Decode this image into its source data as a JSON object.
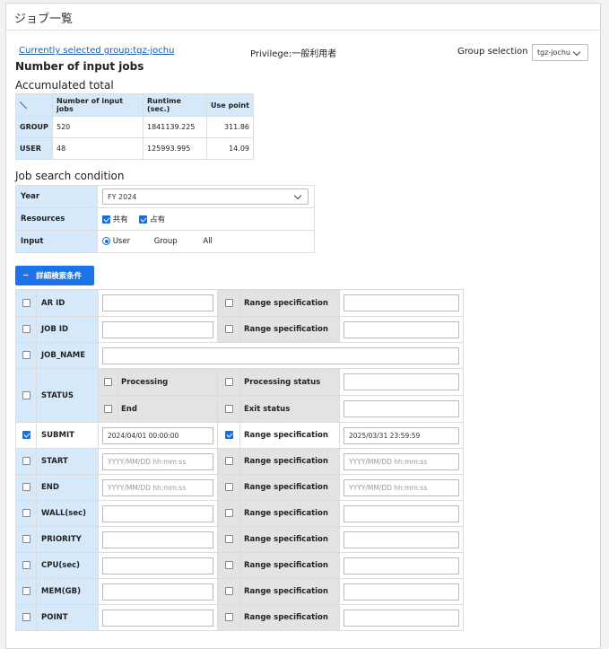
{
  "header": {
    "title": "ジョブ一覧"
  },
  "top": {
    "current_group_link": "Currently selected group:tgz-jochu",
    "privilege": "Privilege:一般利用者",
    "group_selection_label": "Group selection",
    "group_selection_value": "tgz-jochu"
  },
  "sections": {
    "input_jobs_title": "Number of input jobs",
    "accumulated_title": "Accumulated total",
    "search_title": "Job search condition"
  },
  "accumulated": {
    "corner": "＼",
    "columns": [
      "Number of input jobs",
      "Runtime (sec.)",
      "Use point"
    ],
    "rows": [
      {
        "label": "GROUP",
        "jobs": "520",
        "runtime": "1841139.225",
        "point": "311.86"
      },
      {
        "label": "USER",
        "jobs": "48",
        "runtime": "125993.995",
        "point": "14.09"
      }
    ]
  },
  "search": {
    "year_label": "Year",
    "year_value": "FY 2024",
    "resources_label": "Resources",
    "resources": [
      {
        "label": "共有",
        "checked": true
      },
      {
        "label": "占有",
        "checked": true
      }
    ],
    "input_label": "Input",
    "input_options": [
      {
        "label": "User",
        "selected": true
      },
      {
        "label": "Group",
        "selected": false
      },
      {
        "label": "All",
        "selected": false
      }
    ]
  },
  "detail_button": {
    "icon": "minus-icon",
    "symbol": "−",
    "label": "詳細検索条件"
  },
  "fields": {
    "range_label": "Range specification",
    "placeholder_datetime": "YYYY/MM/DD hh:mm:ss",
    "rows": [
      {
        "name": "AR ID"
      },
      {
        "name": "JOB ID"
      },
      {
        "name": "JOB_NAME"
      },
      {
        "name": "STATUS",
        "processing": "Processing",
        "end": "End",
        "processing_status": "Processing status",
        "exit_status": "Exit status"
      },
      {
        "name": "SUBMIT",
        "checked": true,
        "from": "2024/04/01 00:00:00",
        "range_checked": true,
        "to": "2025/03/31 23:59:59"
      },
      {
        "name": "START"
      },
      {
        "name": "END"
      },
      {
        "name": "WALL(sec)"
      },
      {
        "name": "PRIORITY"
      },
      {
        "name": "CPU(sec)"
      },
      {
        "name": "MEM(GB)"
      },
      {
        "name": "POINT"
      }
    ]
  }
}
